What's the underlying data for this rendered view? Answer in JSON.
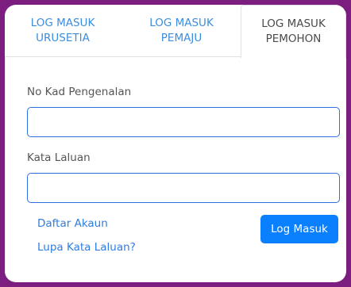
{
  "tabs": [
    {
      "line1": "LOG MASUK",
      "line2": "URUSETIA"
    },
    {
      "line1": "LOG MASUK",
      "line2": "PEMAJU"
    },
    {
      "line1": "LOG MASUK",
      "line2": "PEMOHON"
    }
  ],
  "active_tab": "PEMOHON",
  "form": {
    "id_label": "No Kad Pengenalan",
    "id_value": "",
    "password_label": "Kata Laluan",
    "password_value": "",
    "register_link": "Daftar Akaun",
    "forgot_link": "Lupa Kata Laluan?",
    "submit_label": "Log Masuk"
  },
  "colors": {
    "background": "#7b1e7f",
    "accent": "#0a80ff",
    "link": "#2f7de1"
  }
}
